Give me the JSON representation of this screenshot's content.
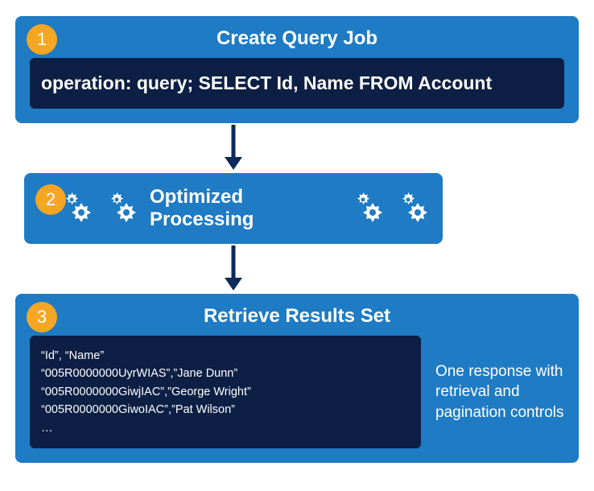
{
  "colors": {
    "box_bg": "#1e7bc4",
    "panel_bg": "#0d1f44",
    "badge_bg": "#f5a623",
    "arrow": "#0d2a5a",
    "text": "#ffffff"
  },
  "step1": {
    "badge": "1",
    "title": "Create Query Job",
    "query": "operation: query; SELECT Id, Name FROM Account"
  },
  "step2": {
    "badge": "2",
    "title": "Optimized Processing"
  },
  "step3": {
    "badge": "3",
    "title": "Retrieve Results Set",
    "results_header": "“Id”, “Name”",
    "results_rows": [
      "“005R0000000UyrWIAS”,”Jane Dunn”",
      "“005R0000000GiwjIAC”,”George Wright”",
      "“005R0000000GiwoIAC”,”Pat Wilson”"
    ],
    "results_ellipsis": "…",
    "side_text": "One response with retrieval and pagination controls"
  }
}
